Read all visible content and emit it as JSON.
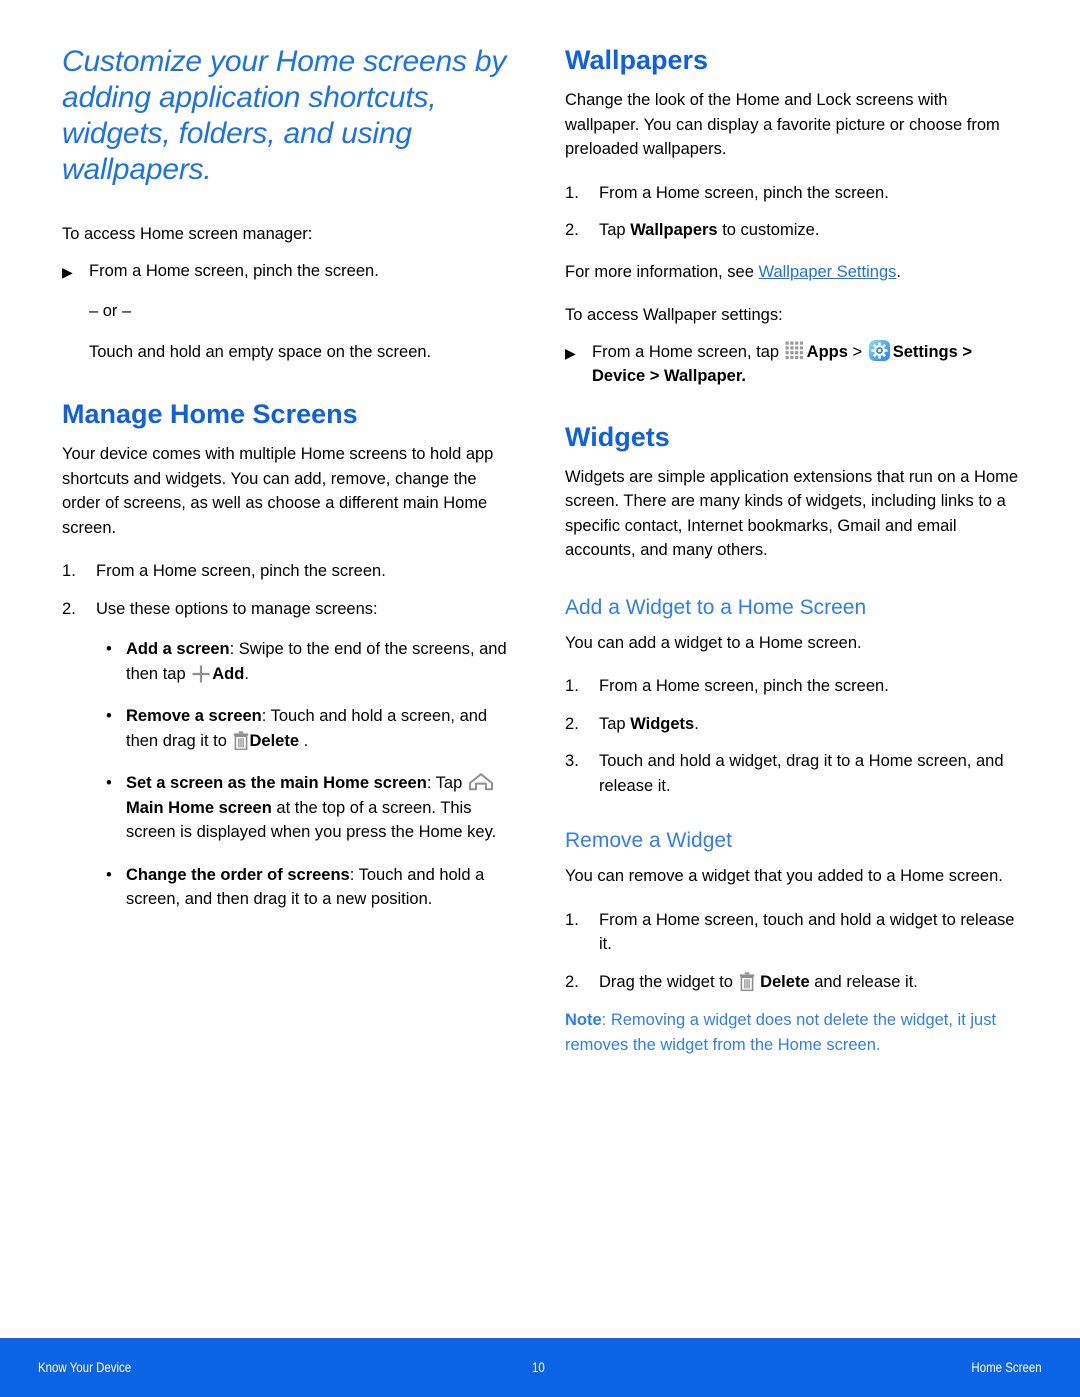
{
  "document": {
    "page_number": "10",
    "footer_left": "Know Your Device",
    "footer_right": "Home Screen"
  },
  "colors": {
    "heading_blue": "#1060e0",
    "subheading_blue": "#2f7ef0",
    "chapter_blue": "#1a73e8",
    "link_blue": "#1a73e8",
    "note_blue": "#2f7ef0",
    "footer_bar": "#0b63e5",
    "icon_gray": "#8a8a8a",
    "settings_icon_start": "#7fd8f5",
    "settings_icon_end": "#2f7ef0"
  },
  "left_column": {
    "chapter_title": "Customize your Home screens by adding application shortcuts, widgets, folders, and using wallpapers.",
    "intro": {
      "lead": "To access Home screen manager:",
      "arrow_item": "From a Home screen, pinch the screen.",
      "or": "– or –",
      "alternative": "Touch and hold an empty space on the screen."
    },
    "manage_home_screens": {
      "heading": "Manage Home Screens",
      "body": "Your device comes with multiple Home screens to hold app shortcuts and widgets. You can add, remove, change the order of screens, as well as choose a different main Home screen.",
      "steps": [
        "From a Home screen, pinch the screen.",
        "Use these options to manage screens:"
      ],
      "options": [
        {
          "label": "Add a screen",
          "text_before": ": Swipe to the end of the screens, and then tap ",
          "icon": "plus-icon",
          "bold_after": "Add",
          "text_after": "."
        },
        {
          "label": "Remove a screen",
          "text_before": ": Touch and hold a screen, and then drag it to ",
          "icon": "trash-icon",
          "bold_after": "Delete",
          "text_after": " ."
        },
        {
          "label": "Set a screen as the main Home screen",
          "text_before": ": Tap ",
          "icon": "home-icon",
          "bold_after": "Main Home screen",
          "text_after": " at the top of a screen. This screen is displayed when you press the Home key."
        },
        {
          "label": "Change the order of screens",
          "text_before": ": Touch and hold a screen, and then drag it to a new position.",
          "icon": "",
          "bold_after": "",
          "text_after": ""
        }
      ]
    }
  },
  "right_column": {
    "wallpapers": {
      "heading": "Wallpapers",
      "body": "Change the look of the Home and Lock screens with wallpaper. You can display a favorite picture or choose from preloaded wallpapers.",
      "step1": "From a Home screen, pinch the screen.",
      "step2_prefix": "Tap ",
      "step2_bold": "Wallpapers",
      "step2_suffix": " to customize.",
      "more_info_prefix": "For more information, see ",
      "more_info_link": "Wallpaper Settings",
      "more_info_suffix": ".",
      "access_lead": "To access Wallpaper settings:",
      "access_prefix": "From a Home screen, tap ",
      "apps_label": "Apps",
      "separator": " > ",
      "settings_label": "Settings",
      "path_tail": "> Device > Wallpaper."
    },
    "widgets": {
      "heading": "Widgets",
      "body": "Widgets are simple application extensions that run on a Home screen. There are many kinds of widgets, including links to a specific contact, Internet bookmarks, Gmail and email accounts, and many others."
    },
    "add_widget": {
      "heading": "Add a Widget to a Home Screen",
      "body": "You can add a widget to a Home screen.",
      "step1": "From a Home screen, pinch the screen.",
      "step2_prefix": "Tap ",
      "step2_bold": "Widgets",
      "step2_suffix": ".",
      "step3": "Touch and hold a widget, drag it to a Home screen, and release it."
    },
    "remove_widget": {
      "heading": "Remove a Widget",
      "body": "You can remove a widget that you added to a Home screen.",
      "step1": "From a Home screen, touch and hold a widget to release it.",
      "step2_prefix": "Drag the widget to ",
      "step2_bold": "Delete",
      "step2_suffix": " and release it.",
      "note_label": "Note",
      "note_text": ": Removing a widget does not delete the widget, it just removes the widget from the Home screen."
    }
  }
}
